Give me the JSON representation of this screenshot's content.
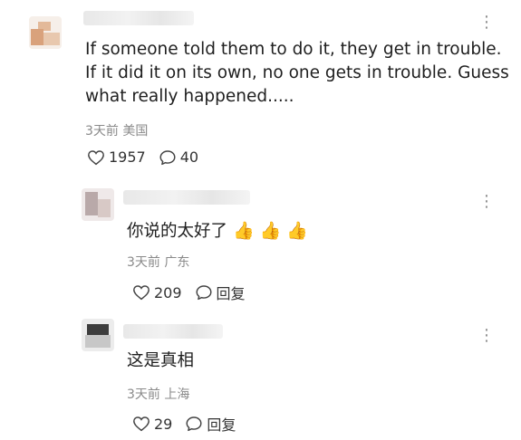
{
  "comments": [
    {
      "text_lines": [
        "If someone told them to do it, they get in trouble.",
        "If it did it on its own, no one gets in trouble. Guess",
        "what really happened....."
      ],
      "meta": "3天前 美国",
      "likes": "1957",
      "replies": "40",
      "more_icon": "⋮"
    },
    {
      "text": "你说的太好了",
      "emojis": [
        "👍",
        "👍",
        "👍"
      ],
      "meta": "3天前 广东",
      "likes": "209",
      "reply_label": "回复",
      "more_icon": "⋮"
    },
    {
      "text": "这是真相",
      "meta": "3天前 上海",
      "likes": "29",
      "reply_label": "回复",
      "more_icon": "⋮"
    }
  ],
  "colors": {
    "text": "#1f1f1f",
    "meta": "#8a8a8a"
  }
}
